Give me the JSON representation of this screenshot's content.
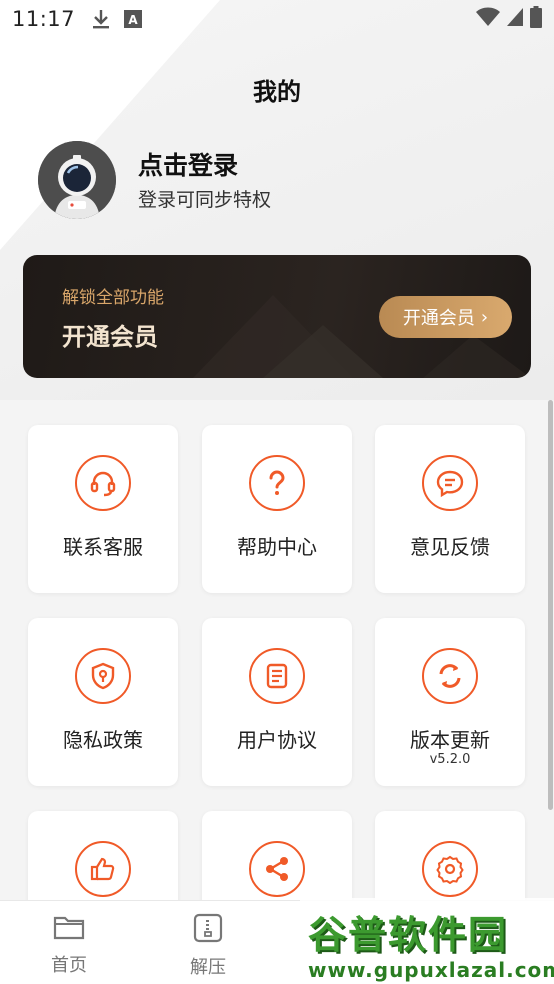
{
  "status_bar": {
    "time": "11:17"
  },
  "header": {
    "title": "我的"
  },
  "profile": {
    "login_title": "点击登录",
    "login_subtitle": "登录可同步特权"
  },
  "vip": {
    "subtitle": "解锁全部功能",
    "title": "开通会员",
    "button_label": "开通会员"
  },
  "grid": [
    {
      "label": "联系客服",
      "icon": "headset-icon"
    },
    {
      "label": "帮助中心",
      "icon": "question-icon"
    },
    {
      "label": "意见反馈",
      "icon": "chat-bubble-icon"
    },
    {
      "label": "隐私政策",
      "icon": "shield-icon"
    },
    {
      "label": "用户协议",
      "icon": "document-icon"
    },
    {
      "label": "版本更新",
      "icon": "refresh-icon",
      "sublabel": "v5.2.0"
    },
    {
      "label": "",
      "icon": "thumbs-up-icon"
    },
    {
      "label": "",
      "icon": "share-icon"
    },
    {
      "label": "",
      "icon": "gear-icon"
    }
  ],
  "bottom_nav": {
    "items": [
      {
        "label": "首页",
        "icon": "folder-icon"
      },
      {
        "label": "解压",
        "icon": "archive-icon"
      }
    ]
  },
  "watermark": {
    "brand": "谷普软件园",
    "url": "www.gupuxlazal.com"
  },
  "colors": {
    "accent": "#f05a28",
    "vip_gold": "#d9a96e",
    "vip_dark": "#1f1a17"
  }
}
